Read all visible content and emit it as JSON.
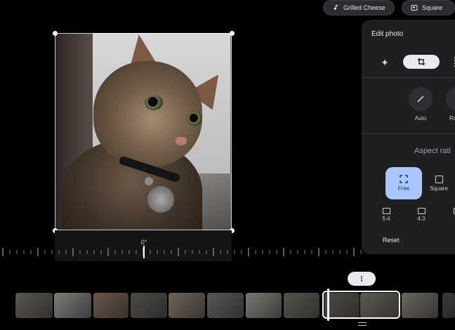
{
  "top_chips": {
    "music_label": "Grilled Cheese",
    "aspect_label": "Square"
  },
  "rotation": {
    "angle_label": "0°"
  },
  "panel": {
    "title": "Edit photo",
    "tools": {
      "auto_label": "Auto",
      "rotate_label": "Ro"
    },
    "aspect_title": "Aspect rati",
    "aspect_options": {
      "free": "Free",
      "square": "Square",
      "ratio_1": "5:4",
      "ratio_2": "4:3",
      "ratio_3": "3"
    },
    "reset_label": "Reset"
  },
  "filmstrip": {
    "thumb_colors": [
      "#5a5550",
      "#7d7d7a",
      "#6b5548",
      "#4d4a46",
      "#6e6558",
      "#565656",
      "#7a7870",
      "#515648",
      "#4f4a44",
      "#5f5a52",
      "#6a6560",
      "#3a3a3a"
    ]
  }
}
